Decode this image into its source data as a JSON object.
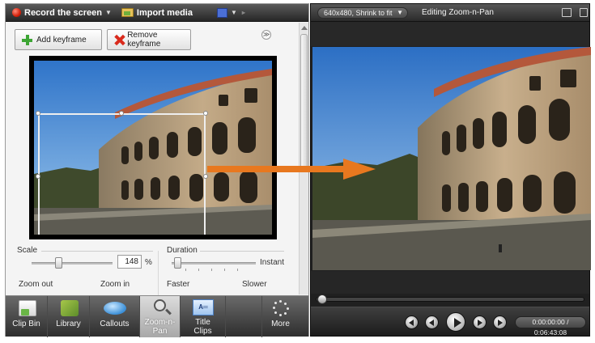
{
  "colors": {
    "accent_arrow": "#e8781f",
    "record_red": "#d4200b",
    "toolbar_dark": "#2e2e2e",
    "panel_bg": "#f2f2f2",
    "preview_bg": "#202020"
  },
  "topbar": {
    "record_label": "Record the screen",
    "import_label": "Import media",
    "icons": [
      "record-dot-icon",
      "folder-icon",
      "film-icon"
    ]
  },
  "keyframes": {
    "add_label": "Add keyframe",
    "remove_label": "Remove keyframe"
  },
  "scale": {
    "label": "Scale",
    "value": "148",
    "unit": "%",
    "left_label": "Zoom out",
    "right_label": "Zoom in"
  },
  "duration": {
    "label": "Duration",
    "value_label": "Instant",
    "left_label": "Faster",
    "right_label": "Slower"
  },
  "toolbar": {
    "items": [
      {
        "line1": "Clip Bin",
        "line2": ""
      },
      {
        "line1": "Library",
        "line2": ""
      },
      {
        "line1": "Callouts",
        "line2": ""
      },
      {
        "line1": "Zoom-n-",
        "line2": "Pan"
      },
      {
        "line1": "Title",
        "line2": "Clips"
      },
      {
        "line1": "More",
        "line2": ""
      }
    ],
    "active": "Zoom-n-Pan"
  },
  "preview": {
    "size_option": "640x480, Shrink to fit",
    "title": "Editing Zoom-n-Pan",
    "time_current": "0:00:00:00",
    "time_total": "0:06:43:08",
    "time_separator": " / "
  }
}
